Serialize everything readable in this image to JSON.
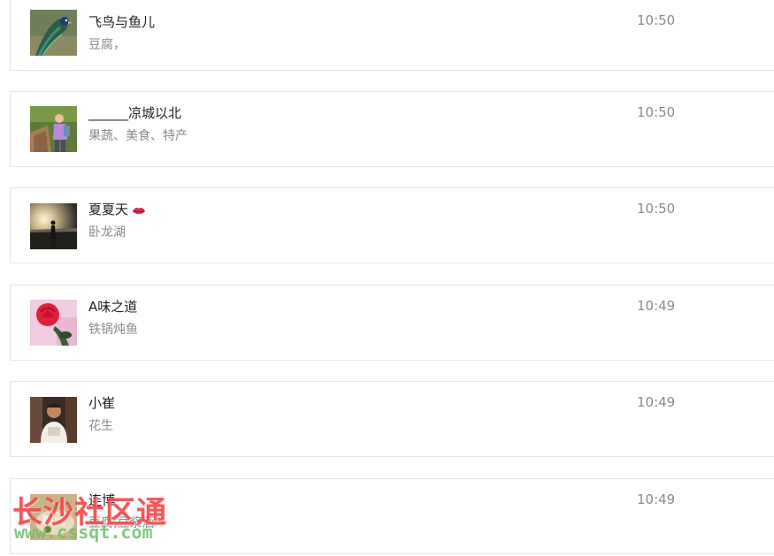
{
  "items": [
    {
      "name": "飞鸟与鱼儿",
      "desc": "豆腐，",
      "time": "10:50",
      "avatar": "peacock-photo"
    },
    {
      "name": "______凉城以北",
      "desc": "果蔬、美食、特产",
      "time": "10:50",
      "avatar": "person-outdoor-photo"
    },
    {
      "name": "夏夏天",
      "desc": "卧龙湖",
      "time": "10:50",
      "avatar": "sunset-silhouette-photo",
      "name_emoji": "lips-icon"
    },
    {
      "name": "A味之道",
      "desc": "铁锅炖鱼",
      "time": "10:49",
      "avatar": "red-rose-photo"
    },
    {
      "name": "小崔",
      "desc": "花生",
      "time": "10:49",
      "avatar": "person-portrait-photo"
    },
    {
      "name": "连博",
      "desc": "豆腐,豆浆酒",
      "time": "10:49",
      "avatar": "food-photo"
    }
  ],
  "watermark": {
    "text": "长沙社区通",
    "url": "www.cssqt.com"
  },
  "colors": {
    "name_text": "#222222",
    "secondary_text": "#8a8a8a",
    "border": "#e6e6e6",
    "watermark_red": "#f04848",
    "watermark_green": "#6cc070"
  }
}
